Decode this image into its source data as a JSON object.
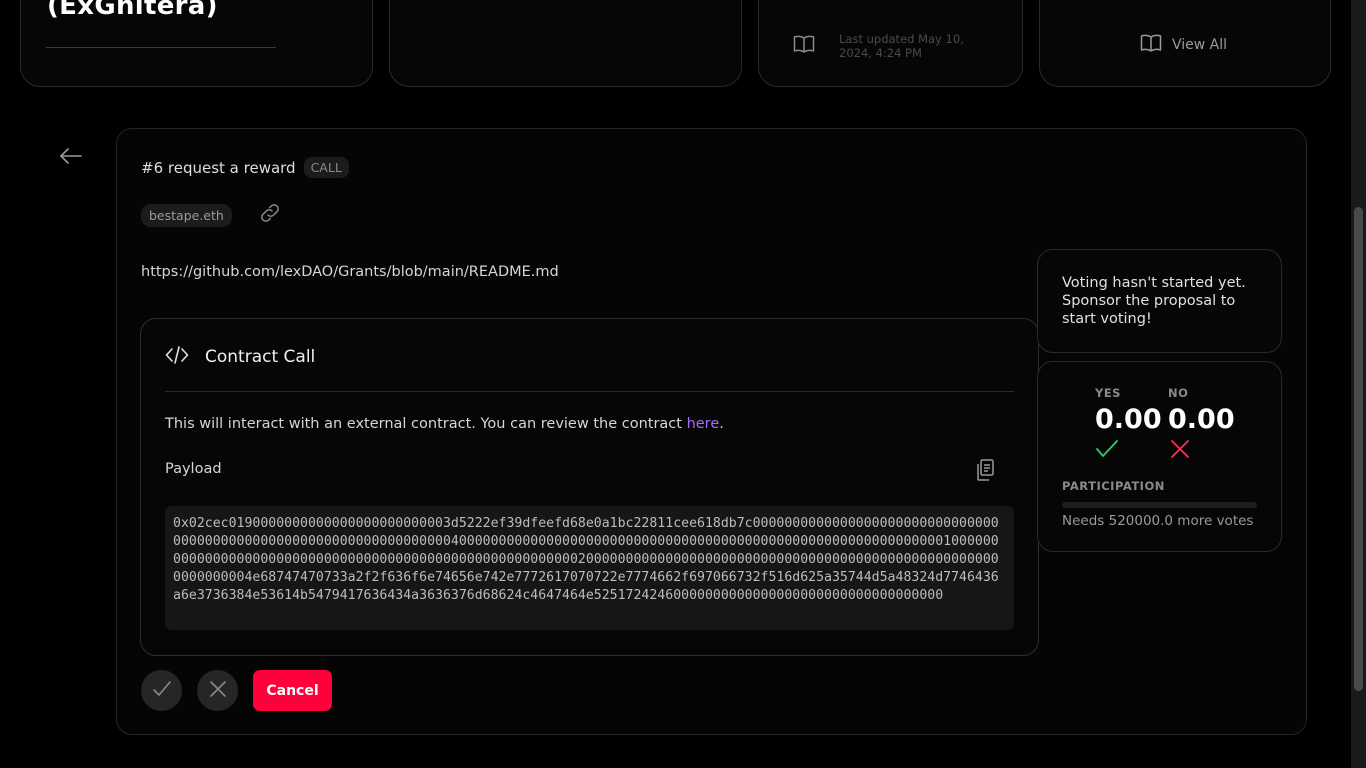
{
  "top_cards": {
    "org_title": "(ExGnitera)",
    "last_updated": "Last updated May 10, 2024, 4:24 PM",
    "view_all_label": "View All",
    "icons": {
      "book": "book-icon"
    }
  },
  "proposal": {
    "title": "#6 request a reward",
    "type_badge": "CALL",
    "author": "bestape.eth",
    "description": "https://github.com/lexDAO/Grants/blob/main/README.md"
  },
  "contract_call": {
    "title": "Contract Call",
    "text_before_link": "This will interact with an external contract. You can review the contract ",
    "link_text": "here",
    "text_after_link": ".",
    "payload_label": "Payload",
    "payload": "0x02cec0190000000000000000000000003d5222ef39dfeefd68e0a1bc22811cee618db7c000000000000000000000000000000000000000000000000000000000000000000400000000000000000000000000000000000000000000000000000000000001000000000000000000000000000000000000000000000000000000000200000000000000000000000000000000000000000000000000000000000004e68747470733a2f2f636f6e74656e742e7772617070722e7774662f697066732f516d625a35744d5a48324d7746436a6e3736384e53614b5479417636434a3636376d68624c4647464e52517242460000000000000000000000000000000000"
  },
  "actions": {
    "cancel_label": "Cancel",
    "yes_icon": "checkmark-icon",
    "no_icon": "x-icon"
  },
  "status": {
    "message": "Voting hasn't started yet. Sponsor the proposal to start voting!"
  },
  "votes": {
    "yes_label": "YES",
    "yes_value": "0.00",
    "no_label": "NO",
    "no_value": "0.00",
    "participation_label": "PARTICIPATION",
    "participation_fraction": 0,
    "needs_text": "Needs 520000.0 more votes"
  },
  "colors": {
    "accent": "#ff003c",
    "link": "#a86bff",
    "yes": "#2ecc71",
    "no": "#ff2d55",
    "background": "#000000"
  }
}
